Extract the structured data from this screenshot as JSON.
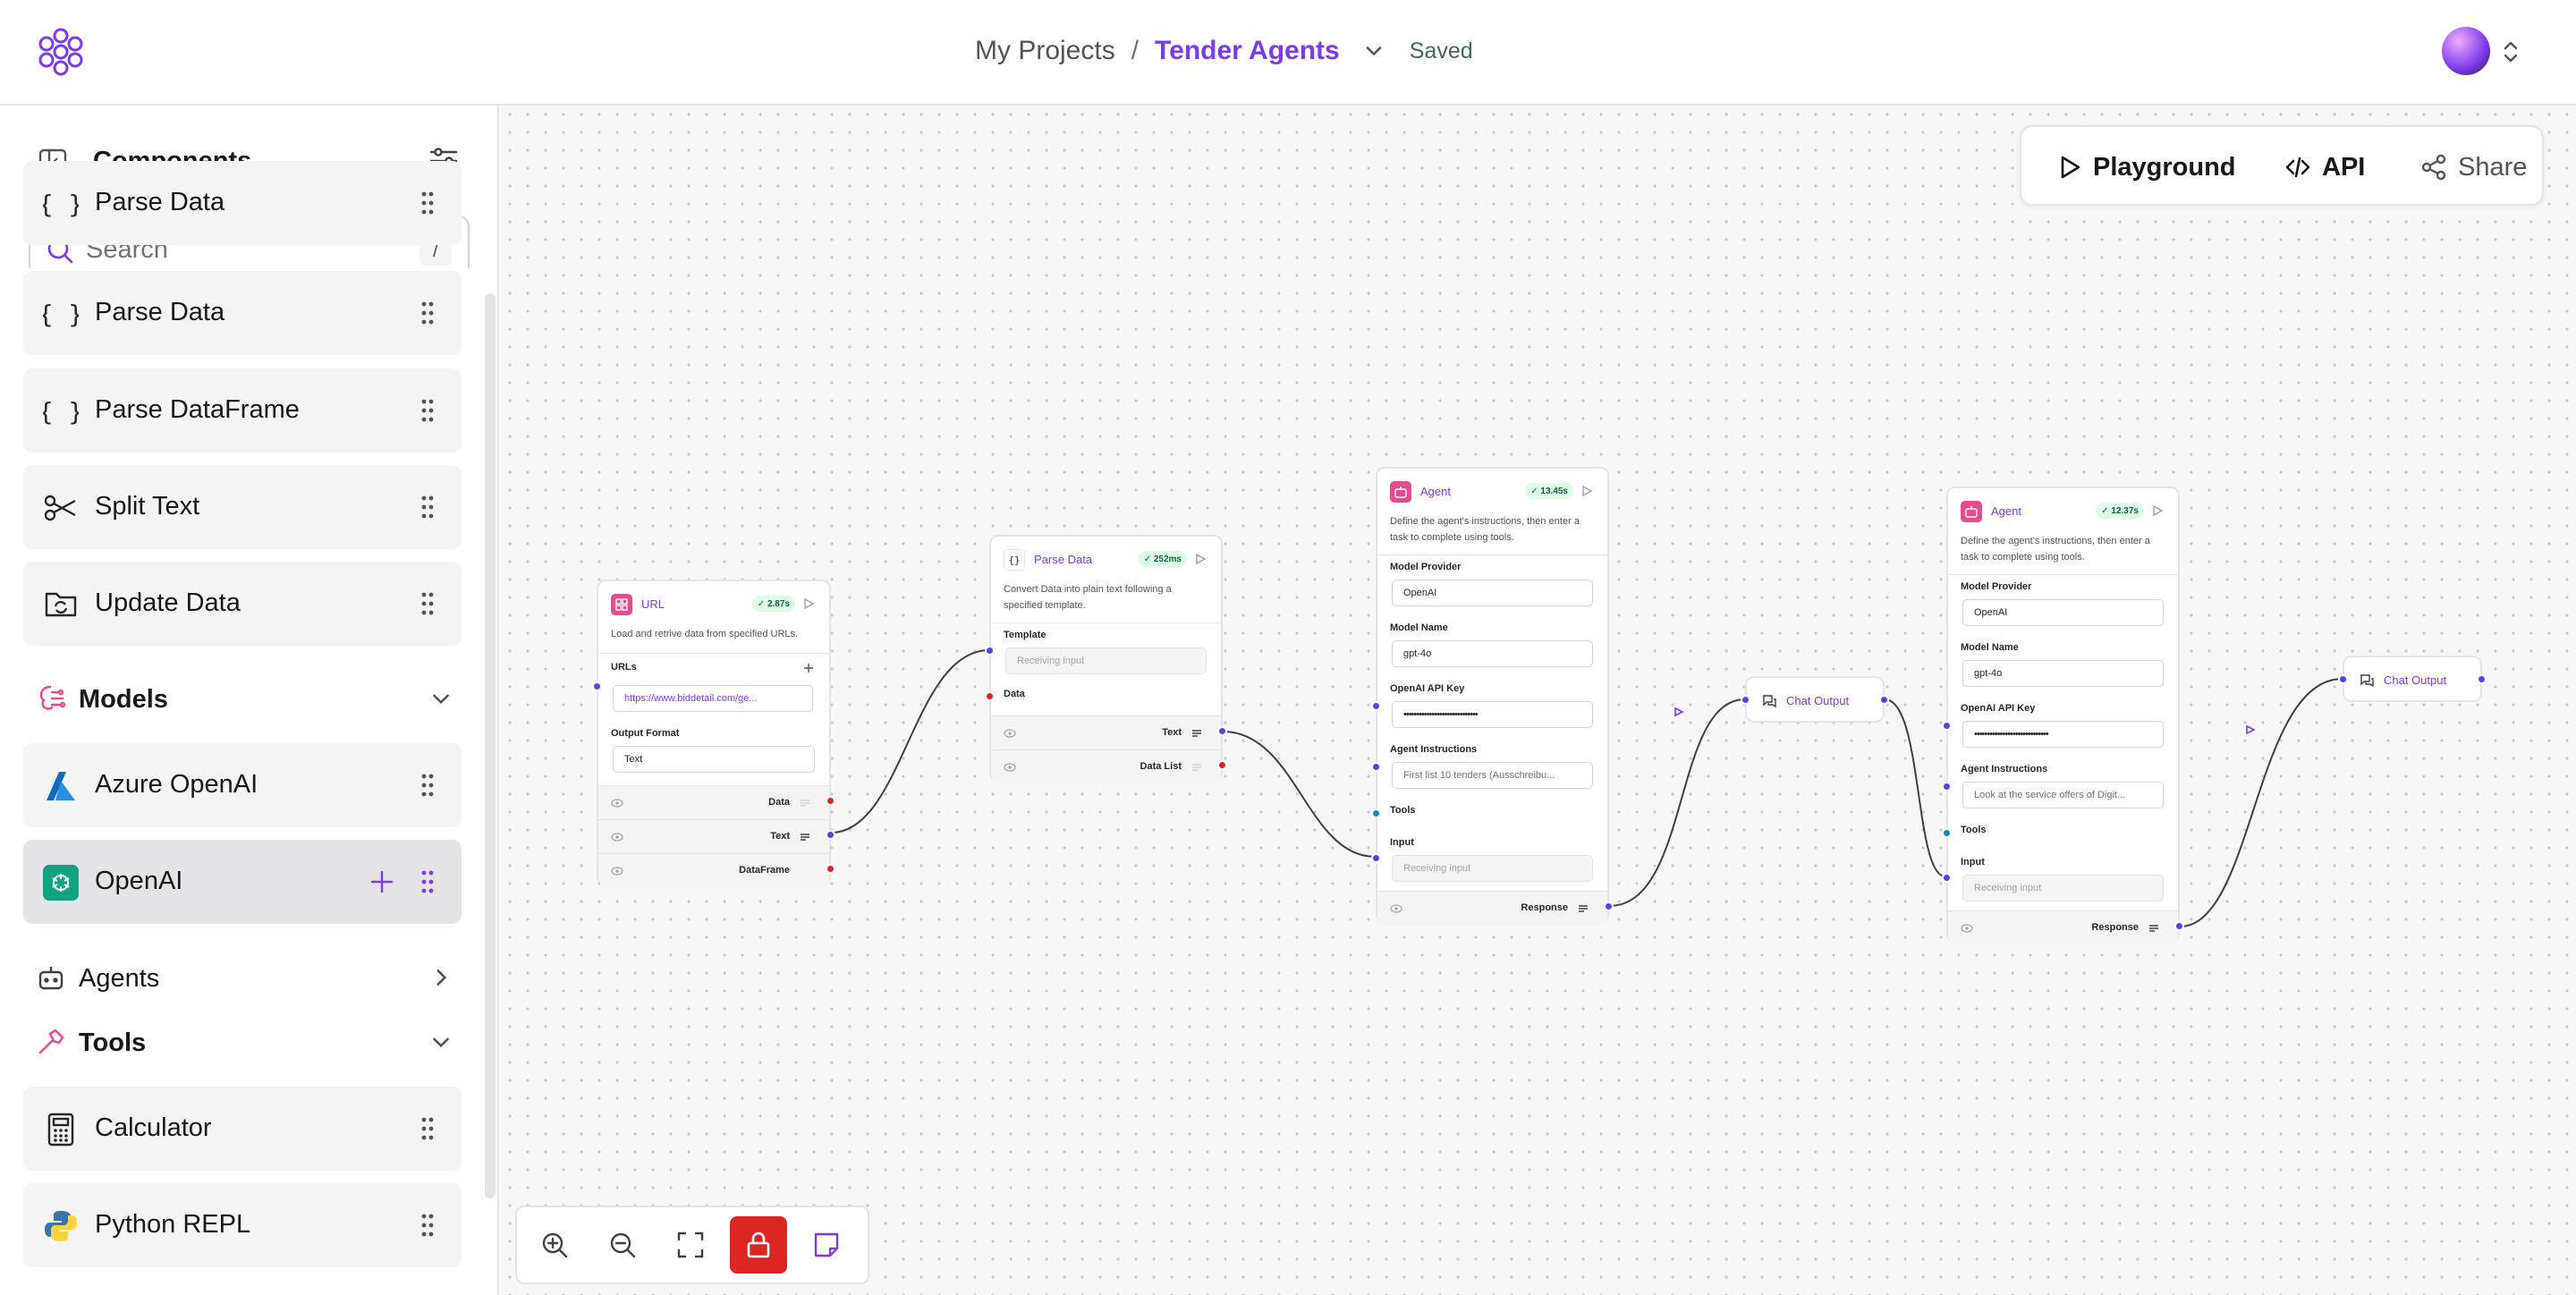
{
  "header": {
    "projects_label": "My Projects",
    "separator": "/",
    "flow_name": "Tender Agents",
    "save_status": "Saved"
  },
  "sidebar": {
    "title": "Components",
    "search_placeholder": "Search",
    "search_shortcut": "/",
    "items": [
      {
        "label": "Parse Data",
        "icon": "braces-icon"
      },
      {
        "label": "Parse DataFrame",
        "icon": "braces-icon"
      },
      {
        "label": "Split Text",
        "icon": "scissors-icon"
      },
      {
        "label": "Update Data",
        "icon": "folder-sync-icon"
      }
    ],
    "categories": {
      "models": {
        "label": "Models",
        "expanded": true
      },
      "agents": {
        "label": "Agents",
        "expanded": false
      },
      "tools": {
        "label": "Tools",
        "expanded": true
      }
    },
    "model_items": [
      {
        "label": "Azure OpenAI",
        "icon": "azure-icon"
      },
      {
        "label": "OpenAI",
        "icon": "openai-icon",
        "selected": true
      }
    ],
    "tool_items": [
      {
        "label": "Calculator",
        "icon": "calculator-icon"
      },
      {
        "label": "Python REPL",
        "icon": "python-icon"
      }
    ]
  },
  "toolbar": {
    "playground_label": "Playground",
    "api_label": "API",
    "share_label": "Share"
  },
  "nodes": {
    "url": {
      "title": "URL",
      "time": "2.87s",
      "description": "Load and retrive data from specified URLs.",
      "urls_label": "URLs",
      "url_value": "https://www.biddetail.com/ge...",
      "format_label": "Output Format",
      "format_value": "Text",
      "outputs": [
        "Data",
        "Text",
        "DataFrame"
      ]
    },
    "parse": {
      "title": "Parse Data",
      "time": "252ms",
      "description": "Convert Data into plain text following a specified template.",
      "template_label": "Template",
      "template_value": "Receiving input",
      "data_label": "Data",
      "outputs": [
        "Text",
        "Data List"
      ]
    },
    "agent1": {
      "title": "Agent",
      "time": "13.45s",
      "description": "Define the agent's instructions, then enter a task to complete using tools.",
      "provider_label": "Model Provider",
      "provider_value": "OpenAI",
      "model_label": "Model Name",
      "model_value": "gpt-4o",
      "key_label": "OpenAI API Key",
      "key_value": "•••••••••••••••••••••••••••••",
      "instructions_label": "Agent Instructions",
      "instructions_value": "First list 10 tenders (Ausschreibu...",
      "tools_label": "Tools",
      "input_label": "Input",
      "input_value": "Receiving input",
      "output": "Response"
    },
    "chat1": {
      "title": "Chat Output"
    },
    "agent2": {
      "title": "Agent",
      "time": "12.37s",
      "description": "Define the agent's instructions, then enter a task to complete using tools.",
      "provider_label": "Model Provider",
      "provider_value": "OpenAI",
      "model_label": "Model Name",
      "model_value": "gpt-4o",
      "key_label": "OpenAI API Key",
      "key_value": "•••••••••••••••••••••••••••••",
      "instructions_label": "Agent Instructions",
      "instructions_value": "Look at the service offers of Digit...",
      "tools_label": "Tools",
      "input_label": "Input",
      "input_value": "Receiving input",
      "output": "Response"
    },
    "chat2": {
      "title": "Chat Output"
    }
  },
  "colors": {
    "accent": "#7c3aed",
    "node_icon": "#e94a8c",
    "lock_button": "#dc2626",
    "handle_blue": "#4f46e5",
    "handle_red": "#dc2626"
  }
}
